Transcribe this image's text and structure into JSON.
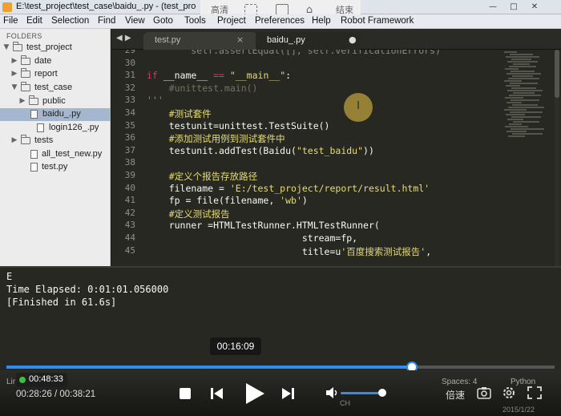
{
  "window": {
    "title": "E:\\test_project\\test_case\\baidu_.py - (test_pro",
    "controls": [
      "—",
      "□",
      "✕"
    ]
  },
  "overlay_toolbar": {
    "hd_label": "高清",
    "end_label": "结束"
  },
  "menu": [
    "File",
    "Edit",
    "Selection",
    "Find",
    "View",
    "Goto",
    "Tools",
    "Project",
    "Preferences",
    "Help",
    "Robot Framework"
  ],
  "sidebar": {
    "header": "FOLDERS",
    "items": [
      {
        "label": "test_project",
        "kind": "folder",
        "depth": 0,
        "expanded": true
      },
      {
        "label": "date",
        "kind": "folder",
        "depth": 1,
        "expanded": false
      },
      {
        "label": "report",
        "kind": "folder",
        "depth": 1,
        "expanded": false
      },
      {
        "label": "test_case",
        "kind": "folder",
        "depth": 1,
        "expanded": true
      },
      {
        "label": "public",
        "kind": "folder",
        "depth": 2,
        "expanded": false
      },
      {
        "label": "baidu_.py",
        "kind": "file",
        "depth": 2,
        "selected": true
      },
      {
        "label": "login126_.py",
        "kind": "file",
        "depth": 2
      },
      {
        "label": "tests",
        "kind": "folder",
        "depth": 1,
        "expanded": false
      },
      {
        "label": "all_test_new.py",
        "kind": "file",
        "depth": 1
      },
      {
        "label": "test.py",
        "kind": "file",
        "depth": 1
      }
    ]
  },
  "tabs": [
    {
      "label": "test.py",
      "active": false,
      "close": "×"
    },
    {
      "label": "baidu_.py",
      "active": true,
      "close": "●"
    }
  ],
  "tab_nav": "◀ ▶",
  "editor": {
    "lines": [
      {
        "n": "29",
        "text": "        self.assertEqual([], self.verificationErrors)"
      },
      {
        "n": "30",
        "text": ""
      },
      {
        "n": "31",
        "text": "if __name__ == \"__main__\":"
      },
      {
        "n": "32",
        "text": "    #unittest.main()"
      },
      {
        "n": "33",
        "text": "'''"
      },
      {
        "n": "34",
        "text": "    #测试套件"
      },
      {
        "n": "35",
        "text": "    testunit=unittest.TestSuite()"
      },
      {
        "n": "36",
        "text": "    #添加测试用例到测试套件中"
      },
      {
        "n": "37",
        "text": "    testunit.addTest(Baidu(\"test_baidu\"))"
      },
      {
        "n": "38",
        "text": ""
      },
      {
        "n": "39",
        "text": "    #定义个报告存放路径"
      },
      {
        "n": "40",
        "text": "    filename = 'E:/test_project/report/result.html'"
      },
      {
        "n": "41",
        "text": "    fp = file(filename, 'wb')"
      },
      {
        "n": "42",
        "text": "    #定义测试报告"
      },
      {
        "n": "43",
        "text": "    runner =HTMLTestRunner.HTMLTestRunner("
      },
      {
        "n": "44",
        "text": "                            stream=fp,"
      },
      {
        "n": "45",
        "text": "                            title=u'百度搜索测试报告',"
      }
    ]
  },
  "console": {
    "lines": [
      "E",
      "Time Elapsed: 0:01:01.056000",
      "[Finished in 61.6s]"
    ]
  },
  "player": {
    "tooltip_time": "00:16:09",
    "preview_time": "00:48:33",
    "current_time": "00:28:26",
    "total_time": "00:38:21",
    "time_separator": " / ",
    "progress": 0.74,
    "volume": 0.9,
    "speed_label": "倍速",
    "status_left": "Lir",
    "spaces_label": "Spaces: 4",
    "language_label": "Python",
    "ime_label": "CH",
    "date_label": "2015/1/22"
  },
  "colors": {
    "editor_bg": "#272822",
    "keyword": "#f92672",
    "comment": "#75715e",
    "string": "#e6db74",
    "progress": "#2f8cf0"
  }
}
